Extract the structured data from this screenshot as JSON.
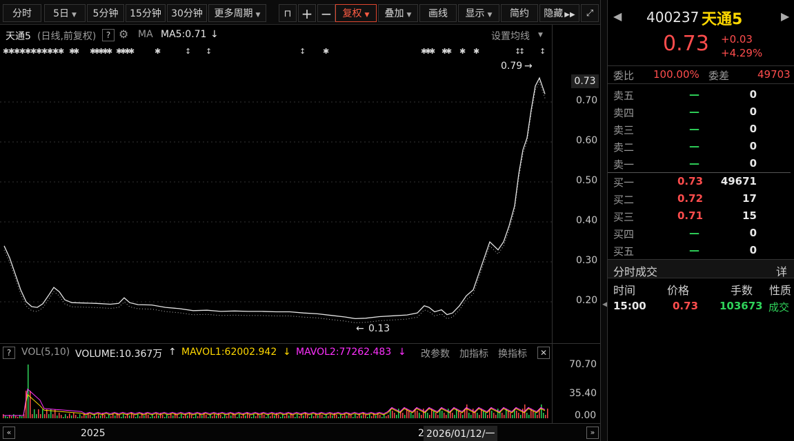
{
  "toolbar": {
    "items": [
      {
        "label": "分时"
      },
      {
        "label": "5日"
      },
      {
        "label": "5分钟"
      },
      {
        "label": "15分钟"
      },
      {
        "label": "30分钟"
      },
      {
        "label": "更多周期"
      },
      {
        "label": "复权"
      },
      {
        "label": "叠加"
      },
      {
        "label": "画线"
      },
      {
        "label": "显示"
      },
      {
        "label": "简约"
      },
      {
        "label": "隐藏"
      }
    ]
  },
  "chart": {
    "title": "天通5",
    "subtitle": "(日线,前复权)",
    "help": "?",
    "ma_label": "MA",
    "ma5": "MA5:0.71",
    "ma_settings": "设置均线",
    "current_price_tag": "0.73",
    "high_annotation": "0.79",
    "low_annotation": "0.13",
    "y_ticks": [
      "0.70",
      "0.60",
      "0.50",
      "0.40",
      "0.30",
      "0.20"
    ]
  },
  "volume": {
    "help": "?",
    "label": "VOL(5,10)",
    "volume": "VOLUME:10.367万",
    "mavol1": "MAVOL1:62002.942",
    "mavol2": "MAVOL2:77262.483",
    "btn_params": "改参数",
    "btn_add": "加指标",
    "btn_switch": "换指标",
    "y_ticks": [
      "70.70",
      "35.40",
      "0.00"
    ]
  },
  "xaxis": {
    "year_label": "2025",
    "cursor_date": "2026/01/12/一",
    "cursor_prefix": "2"
  },
  "quote": {
    "code": "400237",
    "name": "天通5",
    "price": "0.73",
    "change": "+0.03",
    "change_pct": "+4.29%",
    "weibi_label": "委比",
    "weibi_value": "100.00%",
    "weicha_label": "委差",
    "weicha_value": "49703",
    "asks": [
      {
        "label": "卖五",
        "price": "—",
        "vol": "0"
      },
      {
        "label": "卖四",
        "price": "—",
        "vol": "0"
      },
      {
        "label": "卖三",
        "price": "—",
        "vol": "0"
      },
      {
        "label": "卖二",
        "price": "—",
        "vol": "0"
      },
      {
        "label": "卖一",
        "price": "—",
        "vol": "0"
      }
    ],
    "bids": [
      {
        "label": "买一",
        "price": "0.73",
        "vol": "49671"
      },
      {
        "label": "买二",
        "price": "0.72",
        "vol": "17"
      },
      {
        "label": "买三",
        "price": "0.71",
        "vol": "15"
      },
      {
        "label": "买四",
        "price": "—",
        "vol": "0"
      },
      {
        "label": "买五",
        "price": "—",
        "vol": "0"
      }
    ],
    "trades_title": "分时成交",
    "trades_detail": "详",
    "trades_headers": [
      "时间",
      "价格",
      "手数",
      "性质"
    ],
    "trades": [
      {
        "time": "15:00",
        "price": "0.73",
        "qty": "103673",
        "type": "成交"
      }
    ]
  },
  "colors": {
    "up": "#ff4d4d",
    "down": "#2fd35a",
    "accent": "#e0472f",
    "mavol1": "#ffd800",
    "mavol2": "#ff30ff"
  }
}
